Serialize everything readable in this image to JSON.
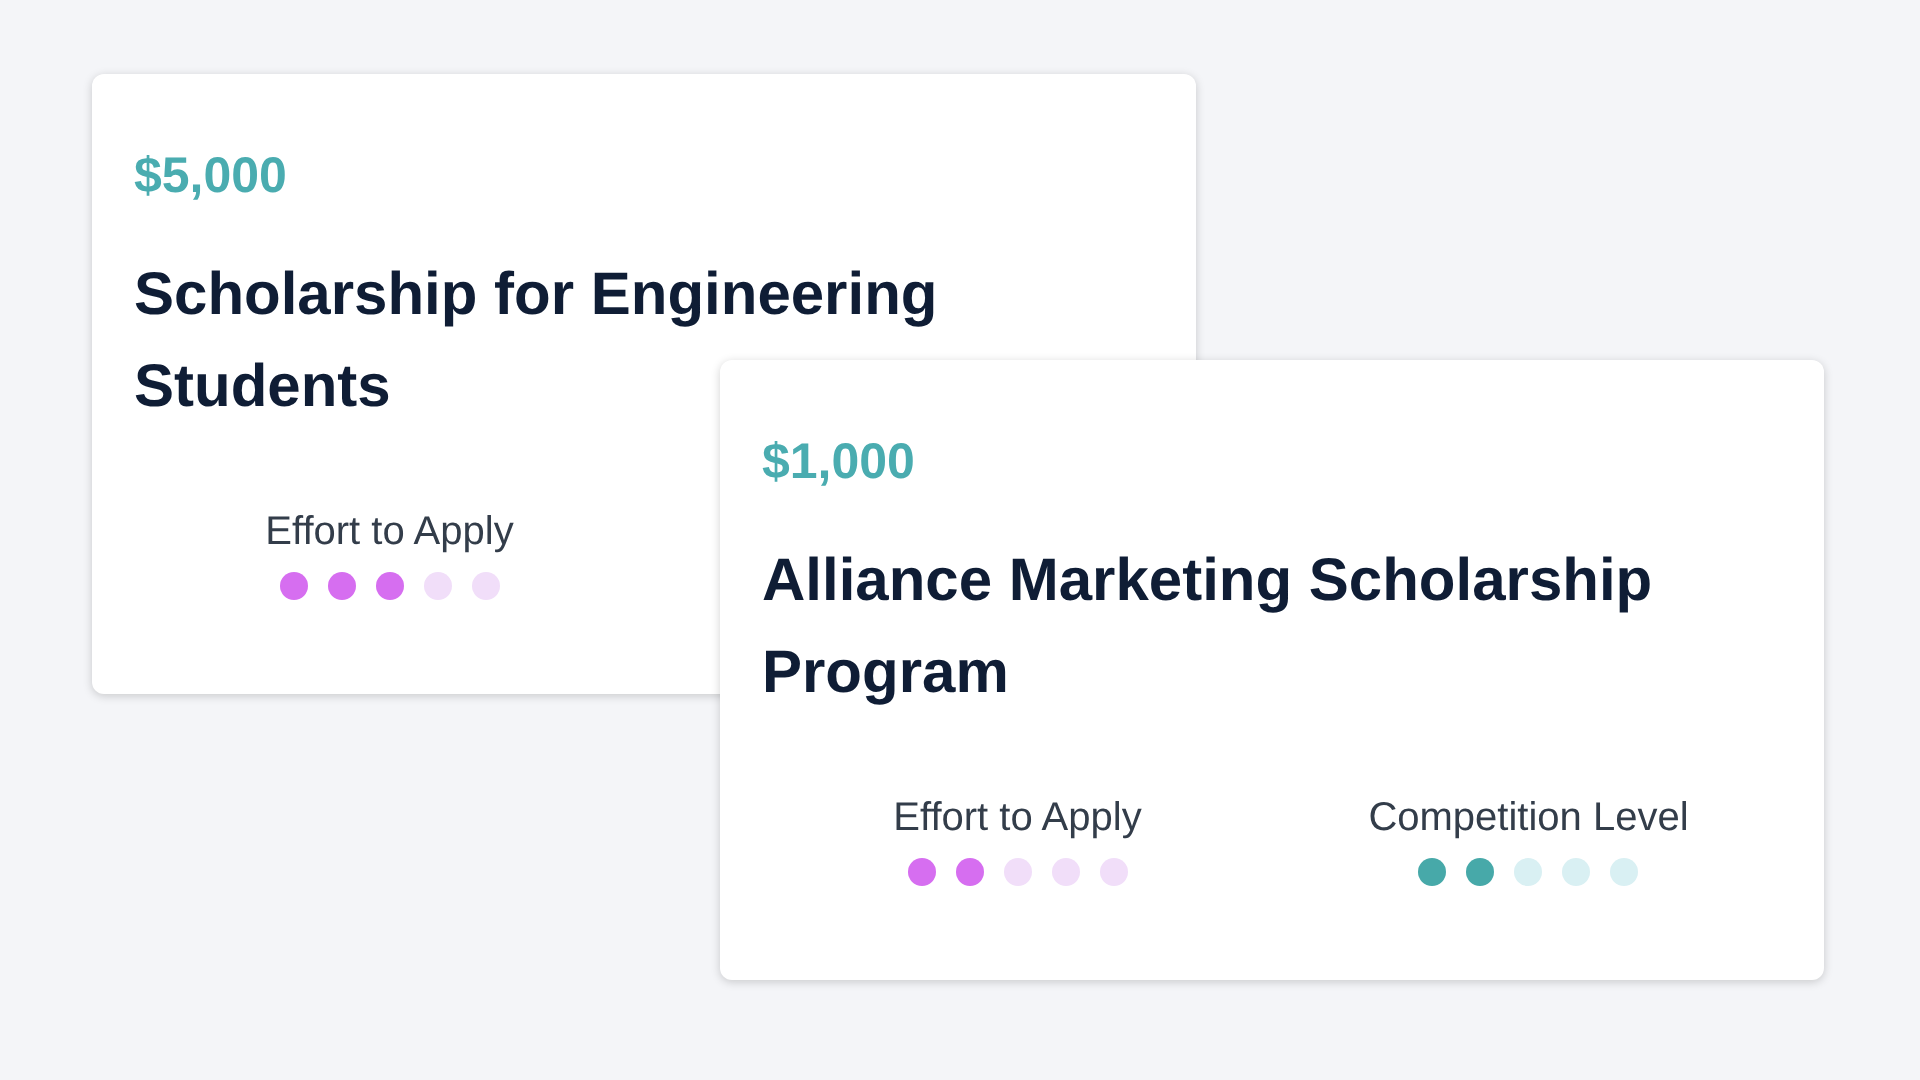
{
  "cards": [
    {
      "amount": "$5,000",
      "title": "Scholarship for Engineering Students",
      "meters": [
        {
          "kind": "effort",
          "label": "Effort to Apply",
          "stars": 3
        }
      ]
    },
    {
      "amount": "$1,000",
      "title": "Alliance Marketing Scholarship Program",
      "meters": [
        {
          "kind": "effort",
          "label": "Effort to Apply",
          "stars": 2
        },
        {
          "kind": "competition",
          "label": "Competition Level",
          "stars": 2
        }
      ]
    }
  ]
}
